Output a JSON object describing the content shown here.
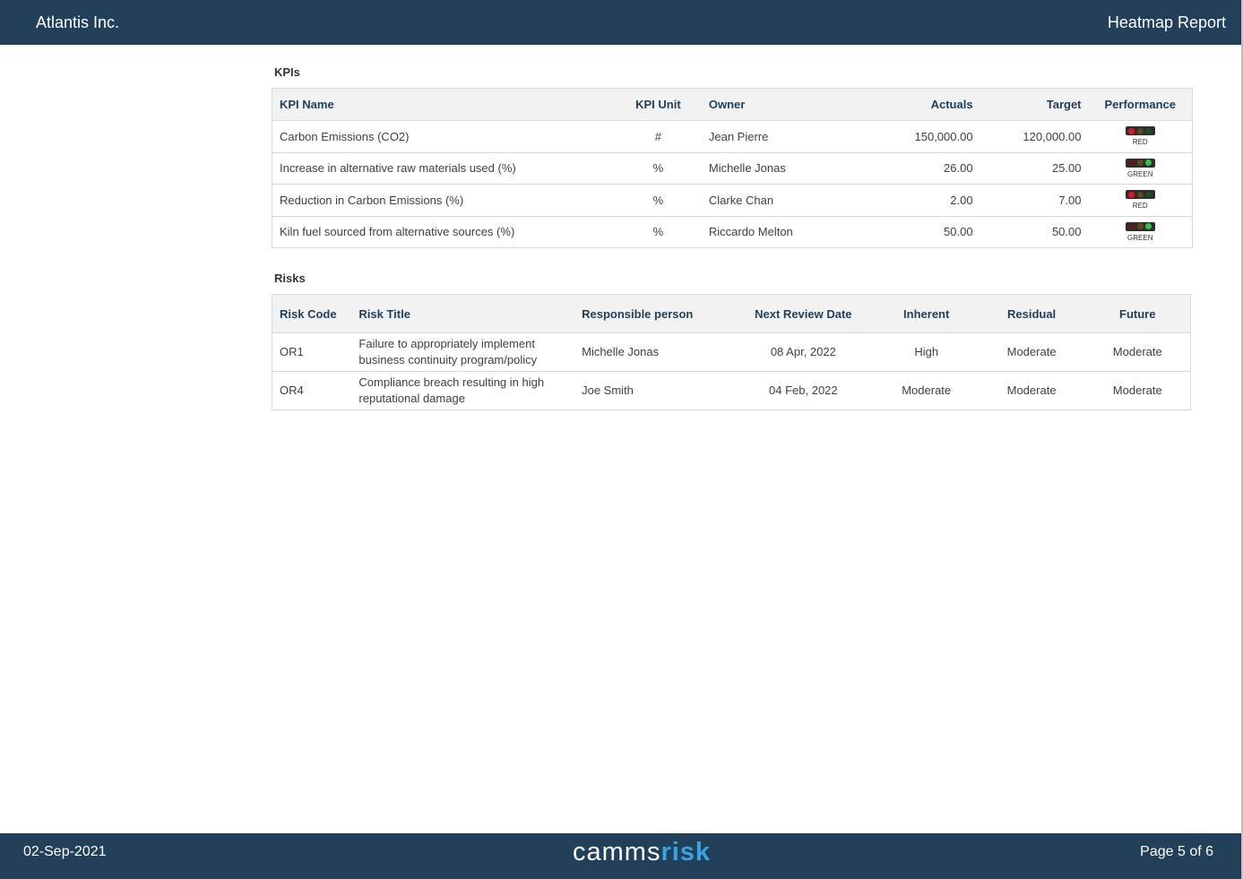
{
  "header": {
    "company": "Atlantis Inc.",
    "report_title": "Heatmap Report"
  },
  "kpis": {
    "section_title": "KPIs",
    "columns": [
      "KPI Name",
      "KPI Unit",
      "Owner",
      "Actuals",
      "Target",
      "Performance"
    ],
    "rows": [
      {
        "name": "Carbon Emissions (CO2)",
        "unit": "#",
        "owner": "Jean Pierre",
        "actuals": "150,000.00",
        "target": "120,000.00",
        "performance": "RED"
      },
      {
        "name": "Increase in alternative raw materials used (%)",
        "unit": "%",
        "owner": "Michelle Jonas",
        "actuals": "26.00",
        "target": "25.00",
        "performance": "GREEN"
      },
      {
        "name": "Reduction in Carbon Emissions (%)",
        "unit": "%",
        "owner": "Clarke Chan",
        "actuals": "2.00",
        "target": "7.00",
        "performance": "RED"
      },
      {
        "name": "Kiln fuel sourced from alternative sources (%)",
        "unit": "%",
        "owner": "Riccardo Melton",
        "actuals": "50.00",
        "target": "50.00",
        "performance": "GREEN"
      }
    ]
  },
  "risks": {
    "section_title": "Risks",
    "columns": [
      "Risk Code",
      "Risk Title",
      "Responsible person",
      "Next Review Date",
      "Inherent",
      "Residual",
      "Future"
    ],
    "rows": [
      {
        "code": "OR1",
        "title": "Failure to appropriately implement business continuity program/policy",
        "person": "Michelle Jonas",
        "review_date": "08 Apr, 2022",
        "inherent": "High",
        "residual": "Moderate",
        "future": "Moderate"
      },
      {
        "code": "OR4",
        "title": "Compliance breach resulting in high reputational damage",
        "person": "Joe Smith",
        "review_date": "04 Feb, 2022",
        "inherent": "Moderate",
        "residual": "Moderate",
        "future": "Moderate"
      }
    ]
  },
  "footer": {
    "date": "02-Sep-2021",
    "logo_part1": "camms",
    "logo_part2": "risk",
    "page": "Page 5 of 6"
  },
  "colors": {
    "header_bg": "#22405a",
    "logo_accent": "#3aa3e3",
    "red_light": "#e8102b",
    "green_light": "#2fc446"
  }
}
